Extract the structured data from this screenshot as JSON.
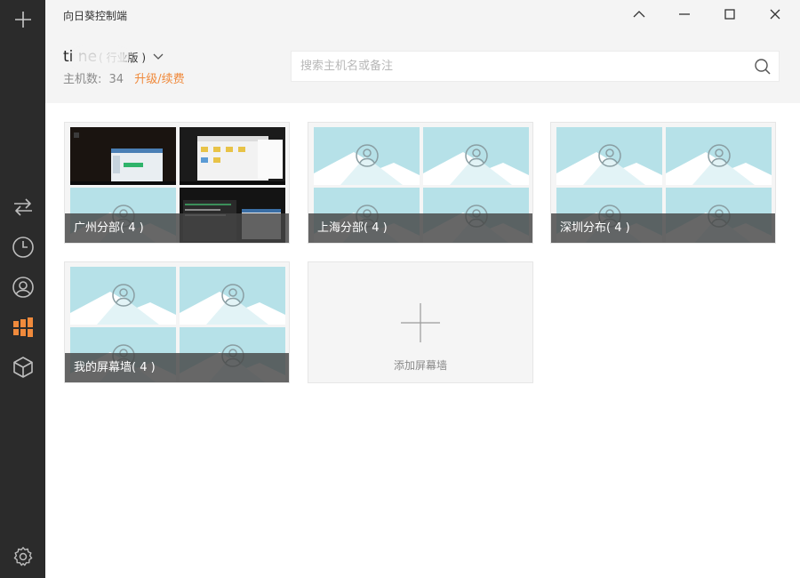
{
  "window": {
    "title": "向日葵控制端",
    "controls": [
      "minimize-to-tray",
      "minimize",
      "maximize",
      "close"
    ]
  },
  "sidebar": {
    "items": [
      {
        "name": "add",
        "icon": "plus-icon"
      },
      {
        "name": "remote-connect",
        "icon": "swap-arrows-icon"
      },
      {
        "name": "history",
        "icon": "clock-icon"
      },
      {
        "name": "discover",
        "icon": "broadcast-icon"
      },
      {
        "name": "screen-wall",
        "icon": "grid-windows-icon",
        "active": true
      },
      {
        "name": "apps",
        "icon": "cube-icon"
      },
      {
        "name": "settings",
        "icon": "gear-icon"
      }
    ]
  },
  "account": {
    "name": "ti    ne",
    "edition": "( 行业版 )",
    "hosts_label": "主机数:",
    "hosts_count": "34",
    "upgrade_label": "升级/续费"
  },
  "search": {
    "placeholder": "搜索主机名或备注",
    "value": ""
  },
  "walls": [
    {
      "label": "广州分部( 4 )",
      "has_screenshots": true
    },
    {
      "label": "上海分部( 4 )",
      "has_screenshots": false
    },
    {
      "label": "深圳分布( 4 )",
      "has_screenshots": false
    },
    {
      "label": "我的屏幕墙( 4 )",
      "has_screenshots": false
    }
  ],
  "add_wall": {
    "label": "添加屏幕墙"
  },
  "colors": {
    "sidebar_bg": "#2b2b2b",
    "accent": "#f08a3c",
    "header_bg": "#f4f4f4",
    "placeholder_sky": "#b6e1e8"
  }
}
